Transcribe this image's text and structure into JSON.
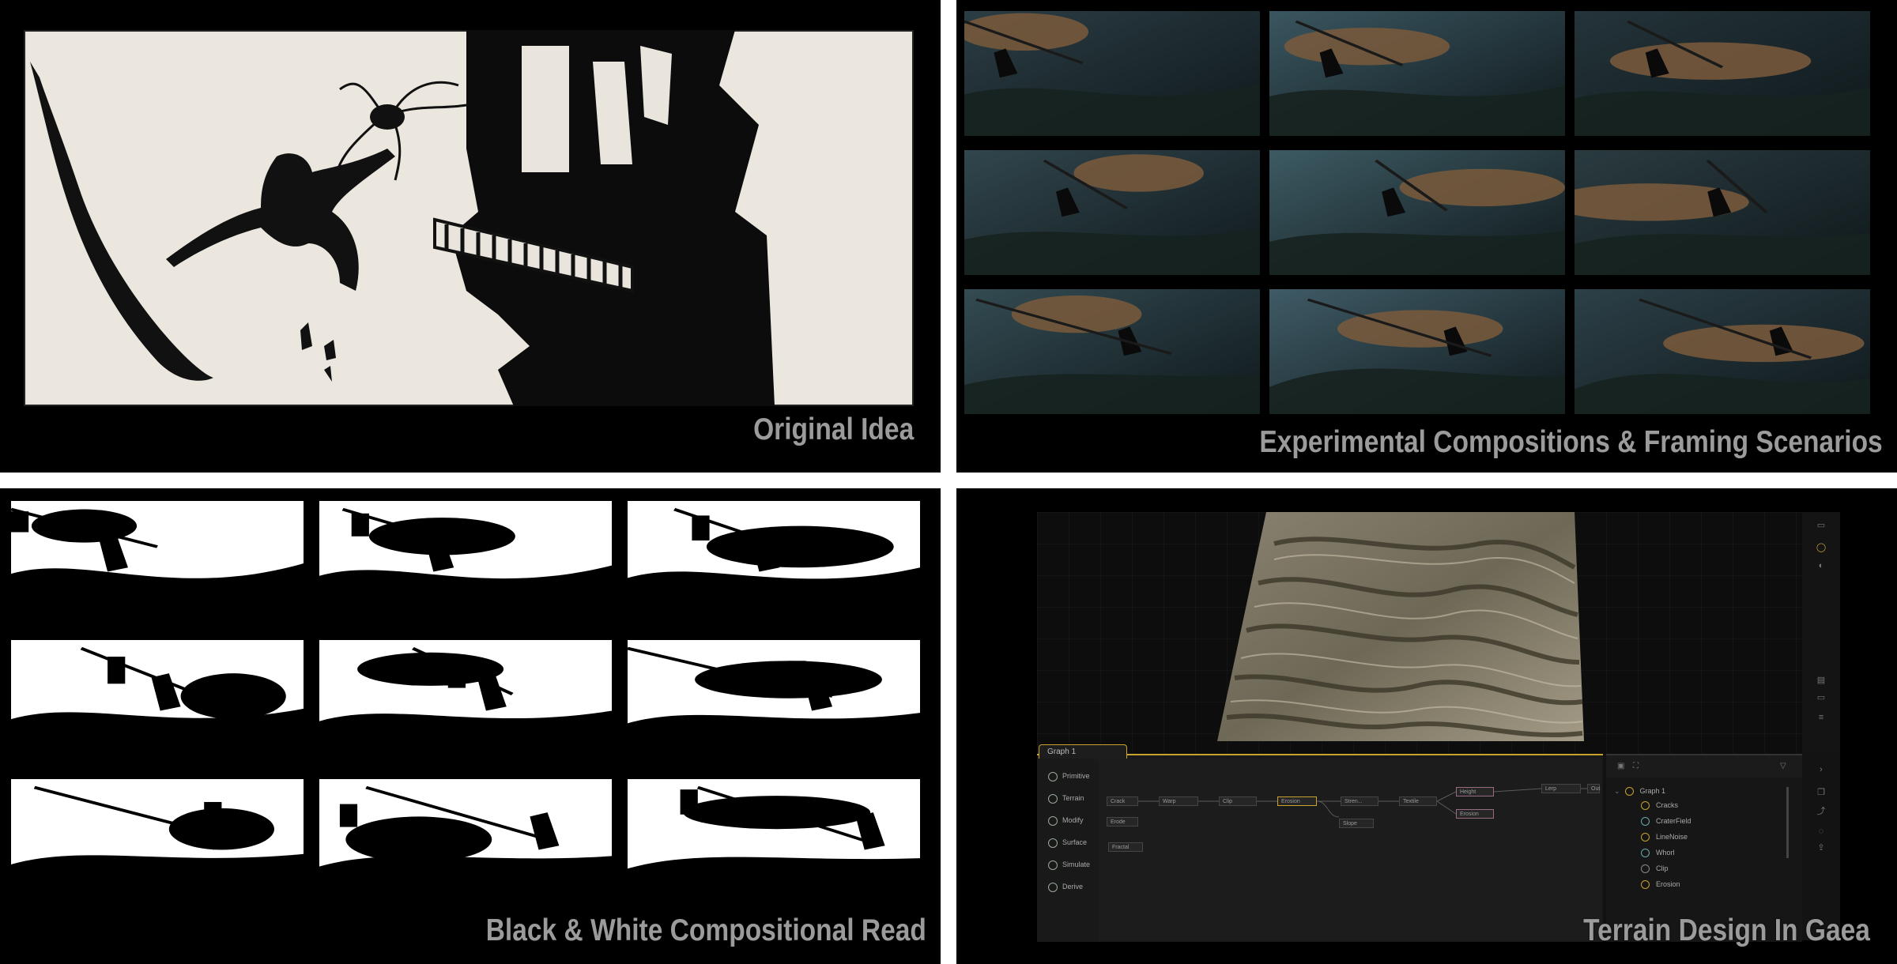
{
  "panels": {
    "original": {
      "caption": "Original Idea"
    },
    "experimental": {
      "caption": "Experimental Compositions & Framing Scenarios"
    },
    "bw": {
      "caption": "Black & White Compositional Read"
    },
    "gaea": {
      "caption": "Terrain Design In Gaea"
    }
  },
  "gaea_ui": {
    "graph_tab": "Graph 1",
    "palette": [
      "Primitive",
      "Terrain",
      "Modify",
      "Surface",
      "Simulate",
      "Derive"
    ],
    "nodes": [
      "Crack",
      "Erode",
      "Warp",
      "Clip",
      "Erosion",
      "Stren...",
      "Textile",
      "Slope",
      "Height",
      "Erosion",
      "Lerp",
      "Out",
      "Fractal"
    ],
    "tree_root": "Graph 1",
    "tree_items": [
      "Cracks",
      "CraterField",
      "LineNoise",
      "Whorl",
      "Clip",
      "Erosion"
    ]
  },
  "colors": {
    "background": "#000000",
    "caption": "#9b9b9b",
    "accent": "#c8a22c"
  }
}
